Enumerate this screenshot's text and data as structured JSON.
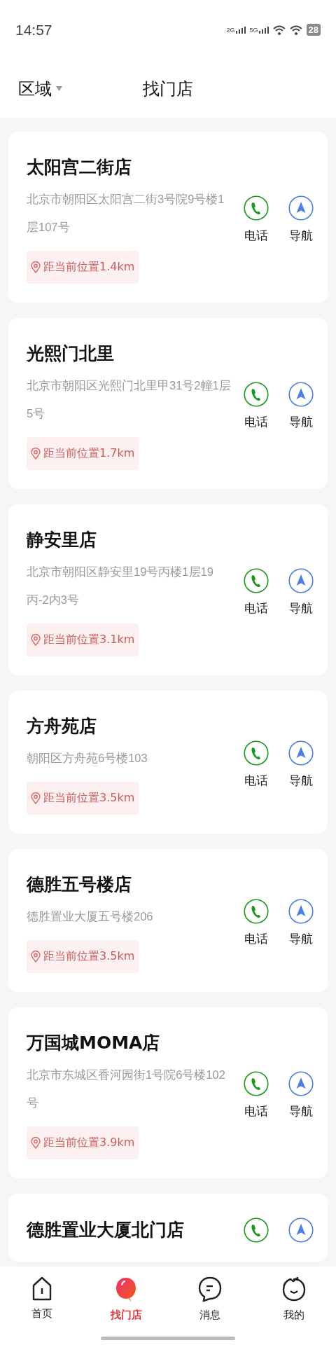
{
  "status_bar": {
    "time": "14:57",
    "network_1": "2G",
    "network_2": "5G",
    "battery": "28"
  },
  "header": {
    "region_filter": "区域",
    "title": "找门店"
  },
  "stores": [
    {
      "name": "太阳宫二街店",
      "address": "北京市朝阳区太阳宫二街3号院9号楼1层107号",
      "distance": "距当前位置1.4km",
      "actions": [
        {
          "kind": "phone",
          "label": "电话"
        },
        {
          "kind": "navigate",
          "label": "导航"
        }
      ]
    },
    {
      "name": "光熙门北里",
      "address": "北京市朝阳区光熙门北里甲31号2幢1层5号",
      "distance": "距当前位置1.7km",
      "actions": [
        {
          "kind": "phone",
          "label": "电话"
        },
        {
          "kind": "navigate",
          "label": "导航"
        }
      ]
    },
    {
      "name": "静安里店",
      "address": "北京市朝阳区静安里19号丙楼1层19丙-2内3号",
      "distance": "距当前位置3.1km",
      "actions": [
        {
          "kind": "phone",
          "label": "电话"
        },
        {
          "kind": "navigate",
          "label": "导航"
        }
      ]
    },
    {
      "name": "方舟苑店",
      "address": "朝阳区方舟苑6号楼103",
      "distance": "距当前位置3.5km",
      "actions": [
        {
          "kind": "phone",
          "label": "电话"
        },
        {
          "kind": "navigate",
          "label": "导航"
        }
      ]
    },
    {
      "name": "德胜五号楼店",
      "address": "德胜置业大厦五号楼206",
      "distance": "距当前位置3.5km",
      "actions": [
        {
          "kind": "phone",
          "label": "电话"
        },
        {
          "kind": "navigate",
          "label": "导航"
        }
      ]
    },
    {
      "name": "万国城MOMA店",
      "address": "北京市东城区香河园街1号院6号楼102号",
      "distance": "距当前位置3.9km",
      "actions": [
        {
          "kind": "phone",
          "label": "电话"
        },
        {
          "kind": "navigate",
          "label": "导航"
        }
      ]
    },
    {
      "name": "德胜置业大厦北门店",
      "actions": [
        {
          "kind": "phone"
        },
        {
          "kind": "navigate"
        }
      ]
    }
  ],
  "tabs": [
    {
      "kind": "home",
      "label": "首页",
      "selected": false
    },
    {
      "kind": "stores",
      "label": "找门店",
      "selected": true
    },
    {
      "kind": "messages",
      "label": "消息",
      "selected": false
    },
    {
      "kind": "profile",
      "label": "我的",
      "selected": false
    }
  ]
}
